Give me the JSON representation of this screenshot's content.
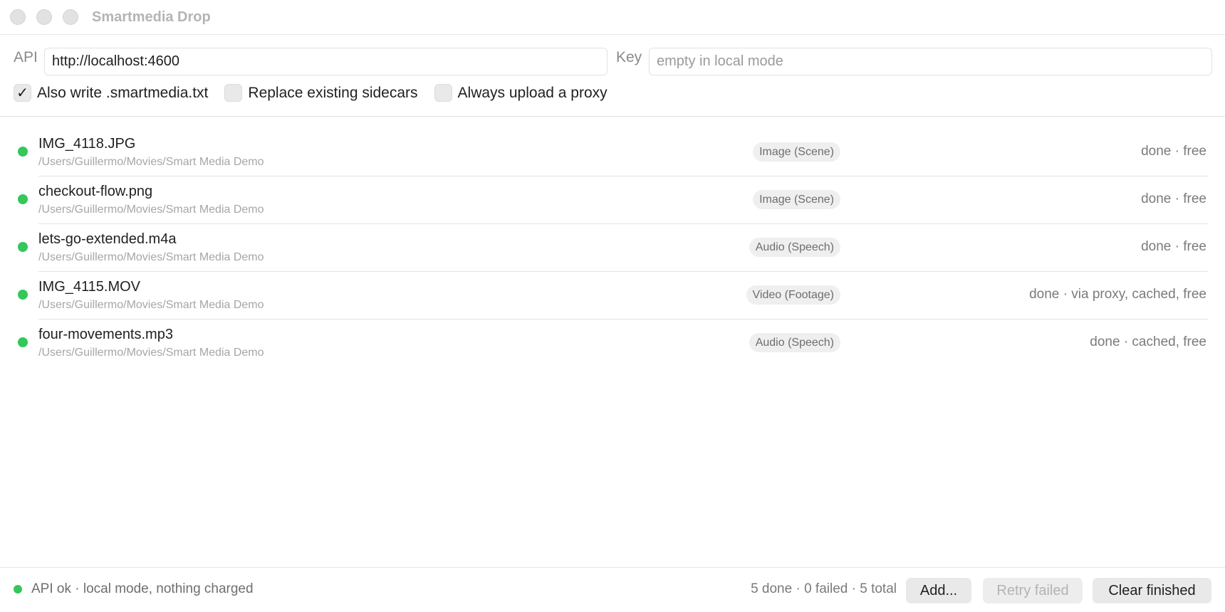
{
  "window": {
    "title": "Smartmedia Drop"
  },
  "settings": {
    "api_label": "API",
    "api_value": "http://localhost:4600",
    "key_label": "Key",
    "key_placeholder": "empty in local mode",
    "checkboxes": [
      {
        "label": "Also write .smartmedia.txt",
        "checked": true,
        "mark": "✓"
      },
      {
        "label": "Replace existing sidecars",
        "checked": false,
        "mark": ""
      },
      {
        "label": "Always upload a proxy",
        "checked": false,
        "mark": ""
      }
    ]
  },
  "files": [
    {
      "name": "IMG_4118.JPG",
      "path": "/Users/Guillermo/Movies/Smart Media Demo",
      "type": "Image (Scene)",
      "status": "done · free",
      "status_color": "#34c759"
    },
    {
      "name": "checkout-flow.png",
      "path": "/Users/Guillermo/Movies/Smart Media Demo",
      "type": "Image (Scene)",
      "status": "done · free",
      "status_color": "#34c759"
    },
    {
      "name": "lets-go-extended.m4a",
      "path": "/Users/Guillermo/Movies/Smart Media Demo",
      "type": "Audio (Speech)",
      "status": "done · free",
      "status_color": "#34c759"
    },
    {
      "name": "IMG_4115.MOV",
      "path": "/Users/Guillermo/Movies/Smart Media Demo",
      "type": "Video (Footage)",
      "status": "done · via proxy, cached, free",
      "status_color": "#34c759"
    },
    {
      "name": "four-movements.mp3",
      "path": "/Users/Guillermo/Movies/Smart Media Demo",
      "type": "Audio (Speech)",
      "status": "done · cached, free",
      "status_color": "#34c759"
    }
  ],
  "footer": {
    "api_status": "API ok · local mode, nothing charged",
    "summary": "5 done · 0 failed · 5 total",
    "add_label": "Add...",
    "retry_label": "Retry failed",
    "clear_label": "Clear finished"
  },
  "colors": {
    "status_ok": "#34c759",
    "button_bg": "#e9e9e9"
  }
}
